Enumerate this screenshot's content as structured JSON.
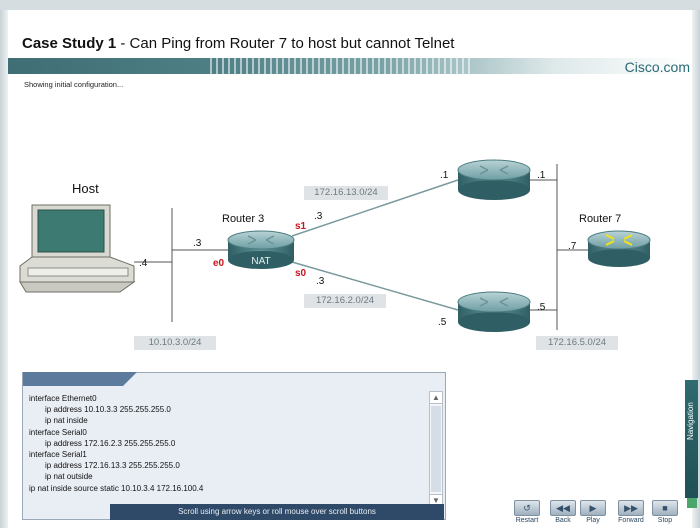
{
  "header": {
    "title_bold": "Case Study 1",
    "title_rest": " - Can Ping from Router 7 to host but cannot Telnet",
    "brand": "Cisco.com",
    "status": "Showing initial configuration..."
  },
  "diagram": {
    "host_label": "Host",
    "router3_label": "Router 3",
    "router3_nat": "NAT",
    "router7_label": "Router 7",
    "iface_e0": "e0",
    "iface_s1": "s1",
    "iface_s0": "s0",
    "host_ip": ".4",
    "r3_e0_ip": ".3",
    "r3_s1_ip": ".3",
    "r3_s0_ip": ".3",
    "top_router_left_ip": ".1",
    "top_router_right_ip": ".1",
    "bottom_router_left_ip": ".5",
    "bottom_router_right_ip": ".5",
    "r7_ip": ".7",
    "subnet_lan": "10.10.3.0/24",
    "subnet_top": "172.16.13.0/24",
    "subnet_bottom": "172.16.2.0/24",
    "subnet_right": "172.16.5.0/24"
  },
  "config": {
    "lines": [
      {
        "text": "interface Ethernet0",
        "indent": 0
      },
      {
        "text": "ip address 10.10.3.3 255.255.255.0",
        "indent": 1
      },
      {
        "text": "ip nat inside",
        "indent": 1
      },
      {
        "text": "interface Serial0",
        "indent": 0
      },
      {
        "text": "ip address 172.16.2.3 255.255.255.0",
        "indent": 1
      },
      {
        "text": "interface Serial1",
        "indent": 0
      },
      {
        "text": "ip address 172.16.13.3 255.255.255.0",
        "indent": 1
      },
      {
        "text": "ip nat outside",
        "indent": 1
      },
      {
        "text": "ip nat inside source static 10.10.3.4 172.16.100.4",
        "indent": 0
      }
    ],
    "scroll_hint": "Scroll using arrow keys or roll mouse over scroll buttons"
  },
  "controls": {
    "restart": "Restart",
    "back": "Back",
    "play": "Play",
    "forward": "Forward",
    "stop": "Stop",
    "navigation": "Navigation"
  }
}
